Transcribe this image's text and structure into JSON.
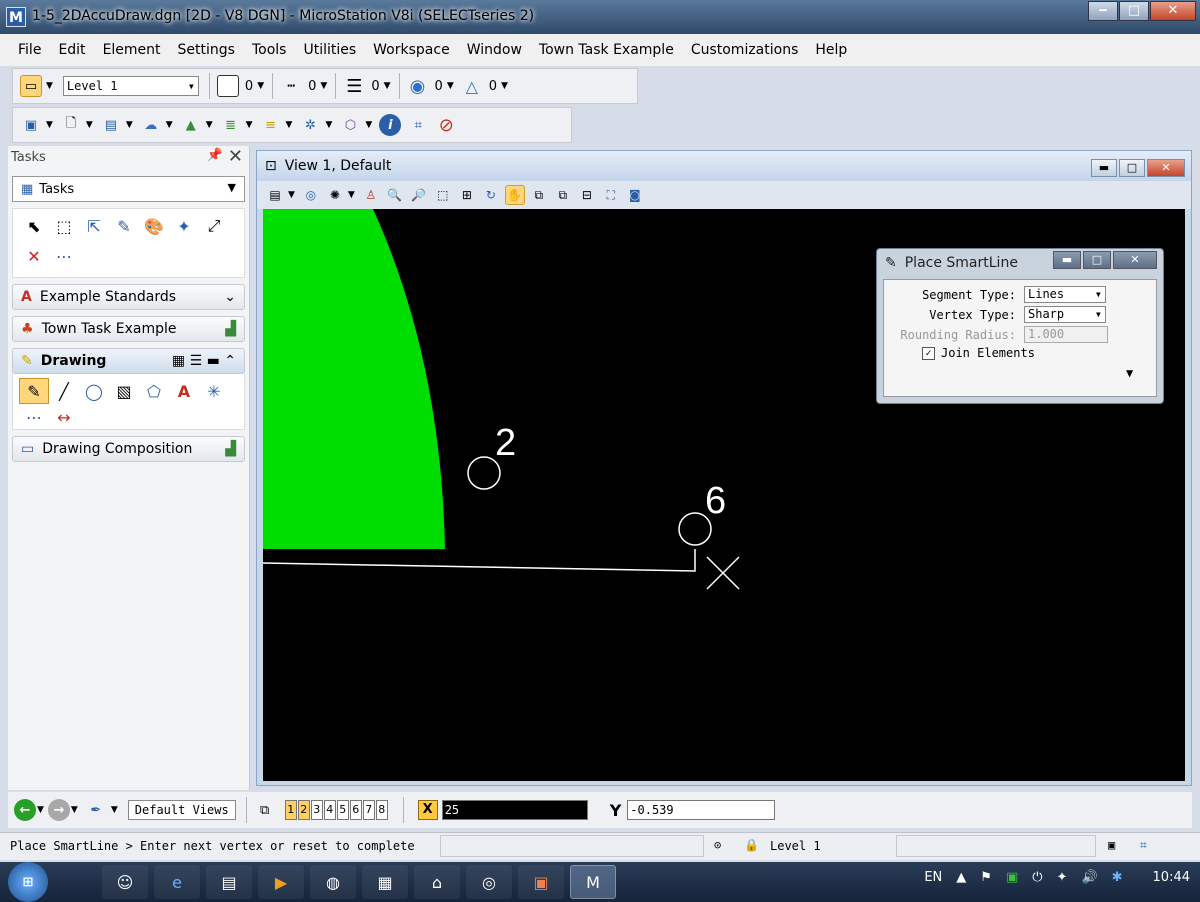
{
  "window": {
    "title": "1-5_2DAccuDraw.dgn [2D - V8 DGN] - MicroStation V8i (SELECTseries 2)",
    "app_icon": "microstation-logo",
    "minimize": "‒",
    "maximize": "□",
    "close": "✕"
  },
  "menu": [
    "File",
    "Edit",
    "Element",
    "Settings",
    "Tools",
    "Utilities",
    "Workspace",
    "Window",
    "Town Task Example",
    "Customizations",
    "Help"
  ],
  "attributes_toolbar": {
    "level": "Level 1",
    "color_value": "0",
    "style_value": "0",
    "weight_value": "0",
    "transparency_value": "0",
    "priority_value": "0"
  },
  "tasks_panel": {
    "title": "Tasks",
    "selected_task": "Tasks",
    "sections": {
      "example_standards": "Example Standards",
      "town_task": "Town Task Example",
      "drawing": "Drawing",
      "drawing_composition": "Drawing Composition"
    },
    "main_tool_keys": [
      "1",
      "2",
      "3",
      "4",
      "5",
      "6",
      "7",
      "8",
      "9"
    ],
    "drawing_tool_keys": [
      "Q",
      "W",
      "E",
      "R",
      "T",
      "A",
      "S",
      "D",
      "F"
    ]
  },
  "view": {
    "title": "View 1, Default",
    "canvas_bg": "#000000",
    "shape_fill": "#00dd00",
    "labels": [
      "2",
      "6"
    ]
  },
  "smartline_dialog": {
    "title": "Place SmartLine",
    "segment_type_label": "Segment Type:",
    "segment_type": "Lines",
    "vertex_type_label": "Vertex Type:",
    "vertex_type": "Sharp",
    "rounding_radius_label": "Rounding Radius:",
    "rounding_radius": "1.000",
    "join_elements_label": "Join Elements",
    "join_elements_checked": "✓"
  },
  "bottom_toolbar": {
    "default_views": "Default Views",
    "view_numbers": [
      "1",
      "2",
      "3",
      "4",
      "5",
      "6",
      "7",
      "8"
    ],
    "x_label": "X",
    "x_value": "25",
    "y_label": "Y",
    "y_value": "-0.539"
  },
  "status": {
    "message": "Place SmartLine > Enter next vertex or reset to complete",
    "level": "Level 1"
  },
  "taskbar": {
    "language": "EN",
    "time": "10:44"
  }
}
